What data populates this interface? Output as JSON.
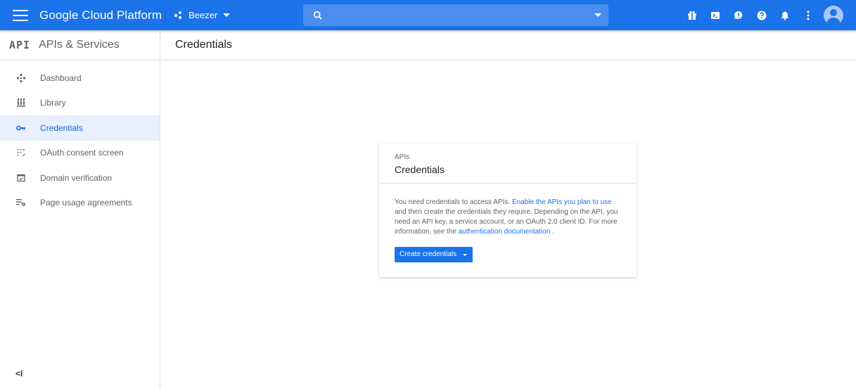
{
  "topbar": {
    "brand": "Google Cloud Platform",
    "project": "Beezer",
    "search_placeholder": "",
    "icons": [
      "gift-icon",
      "cloud-shell-icon",
      "notifications-feedback-icon",
      "help-icon",
      "bell-icon",
      "more-vert-icon",
      "account-avatar"
    ],
    "accent": "#1a73e8"
  },
  "sidebar": {
    "logo": "API",
    "title": "APIs & Services",
    "items": [
      {
        "label": "Dashboard",
        "icon": "dashboard-icon"
      },
      {
        "label": "Library",
        "icon": "library-icon"
      },
      {
        "label": "Credentials",
        "icon": "key-icon",
        "active": true
      },
      {
        "label": "OAuth consent screen",
        "icon": "oauth-icon"
      },
      {
        "label": "Domain verification",
        "icon": "domain-verification-icon"
      },
      {
        "label": "Page usage agreements",
        "icon": "settings-list-icon"
      }
    ],
    "collapse_label": "<I"
  },
  "main": {
    "title": "Credentials",
    "card": {
      "subtitle": "APIs",
      "title": "Credentials",
      "text_1": "You need credentials to access APIs.",
      "link_1": "Enable the APIs you plan to use",
      "text_2": "and then create the credentials they require. Depending on the API, you need an API key, a service account, or an OAuth 2.0 client ID. For more information, see the",
      "link_2": "authentication documentation",
      "text_3": ".",
      "button": "Create credentials"
    }
  }
}
